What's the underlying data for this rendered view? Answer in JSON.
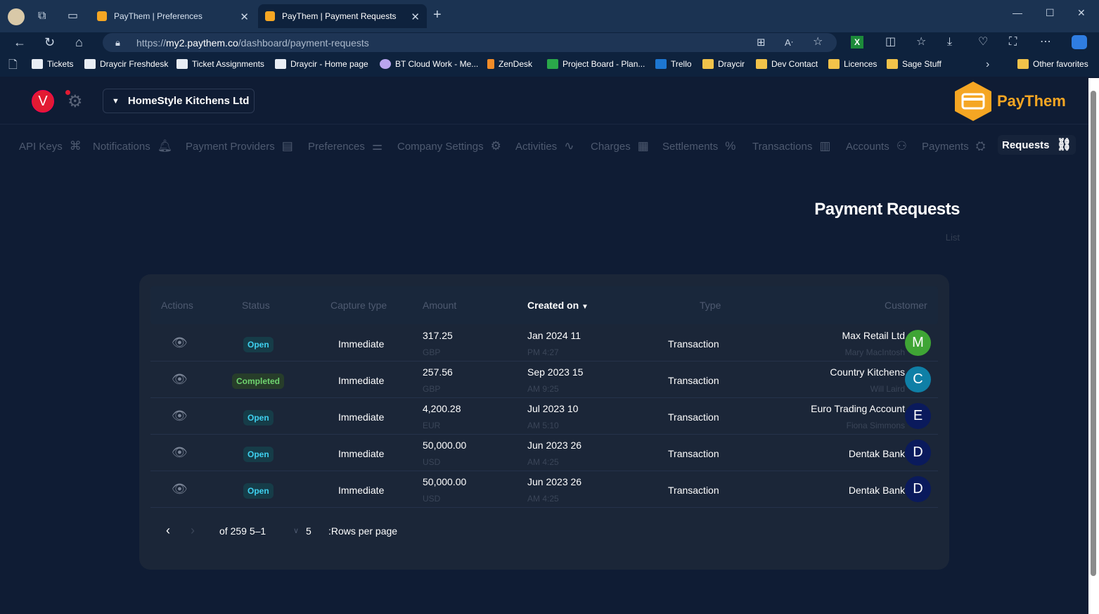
{
  "browser": {
    "tabs": [
      {
        "title": "PayThem | Preferences",
        "active": false
      },
      {
        "title": "PayThem | Payment Requests",
        "active": true
      }
    ],
    "url_prefix": "https://",
    "url_domain": "my2.paythem.co",
    "url_path": "/dashboard/payment-requests",
    "favorites": [
      {
        "label": "Tickets",
        "icon": "page-favicon"
      },
      {
        "label": "Draycir Freshdesk",
        "icon": "page-favicon"
      },
      {
        "label": "Ticket Assignments",
        "icon": "page-favicon"
      },
      {
        "label": "Draycir - Home page",
        "icon": "page-favicon"
      },
      {
        "label": "BT Cloud Work - Me...",
        "icon": "page-favicon"
      },
      {
        "label": "ZenDesk",
        "icon": "zendesk-favicon"
      },
      {
        "label": "Project Board - Plan...",
        "icon": "planner-favicon"
      },
      {
        "label": "Trello",
        "icon": "trello-favicon"
      },
      {
        "label": "Draycir",
        "icon": "folder-icon"
      },
      {
        "label": "Dev Contact",
        "icon": "folder-icon"
      },
      {
        "label": "Licences",
        "icon": "folder-icon"
      },
      {
        "label": "Sage Stuff",
        "icon": "folder-icon"
      }
    ],
    "other_favorites": "Other favorites"
  },
  "app": {
    "user_initial": "V",
    "company": "HomeStyle Kitchens Ltd",
    "logo_text": "PayThem",
    "nav": [
      {
        "label": "API Keys",
        "icon": "api-icon"
      },
      {
        "label": "Notifications",
        "icon": "bell-icon"
      },
      {
        "label": "Payment Providers",
        "icon": "card-icon"
      },
      {
        "label": "Preferences",
        "icon": "sliders-icon"
      },
      {
        "label": "Company Settings",
        "icon": "gear-icon"
      },
      {
        "label": "Activities",
        "icon": "pulse-icon"
      },
      {
        "label": "Charges",
        "icon": "calculator-icon"
      },
      {
        "label": "Settlements",
        "icon": "percent-icon"
      },
      {
        "label": "Transactions",
        "icon": "receipt-icon"
      },
      {
        "label": "Accounts",
        "icon": "users-icon"
      },
      {
        "label": "Payments",
        "icon": "coin-icon"
      },
      {
        "label": "Requests",
        "icon": "link-icon"
      }
    ],
    "page_title": "Payment Requests",
    "page_subtitle": "List"
  },
  "table": {
    "headers": {
      "actions": "Actions",
      "status": "Status",
      "capture": "Capture type",
      "amount": "Amount",
      "created": "Created on",
      "type": "Type",
      "customer": "Customer"
    },
    "rows": [
      {
        "status": "Open",
        "capture": "Immediate",
        "amount": "317.25",
        "currency": "GBP",
        "date": "Jan 2024 11",
        "time": "PM 4:27",
        "type": "Transaction",
        "customer": "Max Retail Ltd",
        "contact": "Mary MacIntosh",
        "initial": "M",
        "avatar_color": "#3fa535"
      },
      {
        "status": "Completed",
        "capture": "Immediate",
        "amount": "257.56",
        "currency": "GBP",
        "date": "Sep 2023 15",
        "time": "AM 9:25",
        "type": "Transaction",
        "customer": "Country Kitchens",
        "contact": "Will Laird",
        "initial": "C",
        "avatar_color": "#0f7fa6"
      },
      {
        "status": "Open",
        "capture": "Immediate",
        "amount": "4,200.28",
        "currency": "EUR",
        "date": "Jul 2023 10",
        "time": "AM 5:10",
        "type": "Transaction",
        "customer": "Euro Trading Account",
        "contact": "Fiona Simmons",
        "initial": "E",
        "avatar_color": "#0a1a5c"
      },
      {
        "status": "Open",
        "capture": "Immediate",
        "amount": "50,000.00",
        "currency": "USD",
        "date": "Jun 2023 26",
        "time": "AM 4:25",
        "type": "Transaction",
        "customer": "Dentak Bank",
        "contact": "",
        "initial": "D",
        "avatar_color": "#0a1a5c"
      },
      {
        "status": "Open",
        "capture": "Immediate",
        "amount": "50,000.00",
        "currency": "USD",
        "date": "Jun 2023 26",
        "time": "AM 4:25",
        "type": "Transaction",
        "customer": "Dentak Bank",
        "contact": "",
        "initial": "D",
        "avatar_color": "#0a1a5c"
      }
    ],
    "pagination": {
      "range": "of 259 5–1",
      "rows_per_page_value": "5",
      "rows_per_page_label": ":Rows per page"
    }
  }
}
